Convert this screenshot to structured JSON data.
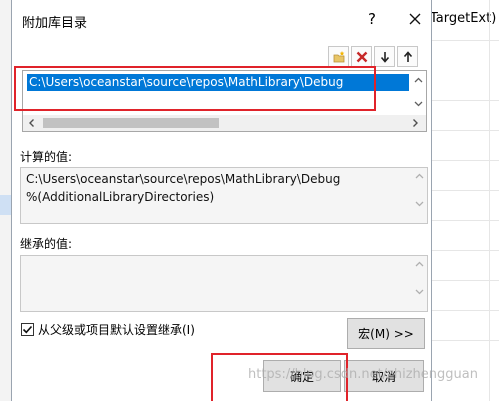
{
  "background_window": {
    "right_text": "TargetExt)"
  },
  "dialog": {
    "title": "附加库目录",
    "help_glyph": "?",
    "list_items": [
      "C:\\Users\\oceanstar\\source\\repos\\MathLibrary\\Debug"
    ],
    "computed_label": "计算的值:",
    "computed_lines": [
      "C:\\Users\\oceanstar\\source\\repos\\MathLibrary\\Debug",
      "%(AdditionalLibraryDirectories)"
    ],
    "inherited_label": "继承的值:",
    "inherit_checkbox_label": "从父级或项目默认设置继承(I)",
    "inherit_checked": true,
    "macro_button_label": "宏(M) >>",
    "ok_button_label": "确定",
    "cancel_button_label": "取消"
  },
  "watermark": "https://blog.csdn.net/zhizhengguan",
  "colors": {
    "selection": "#0078d7",
    "highlight_box": "#e0232a",
    "delete_icon": "#c62828"
  }
}
